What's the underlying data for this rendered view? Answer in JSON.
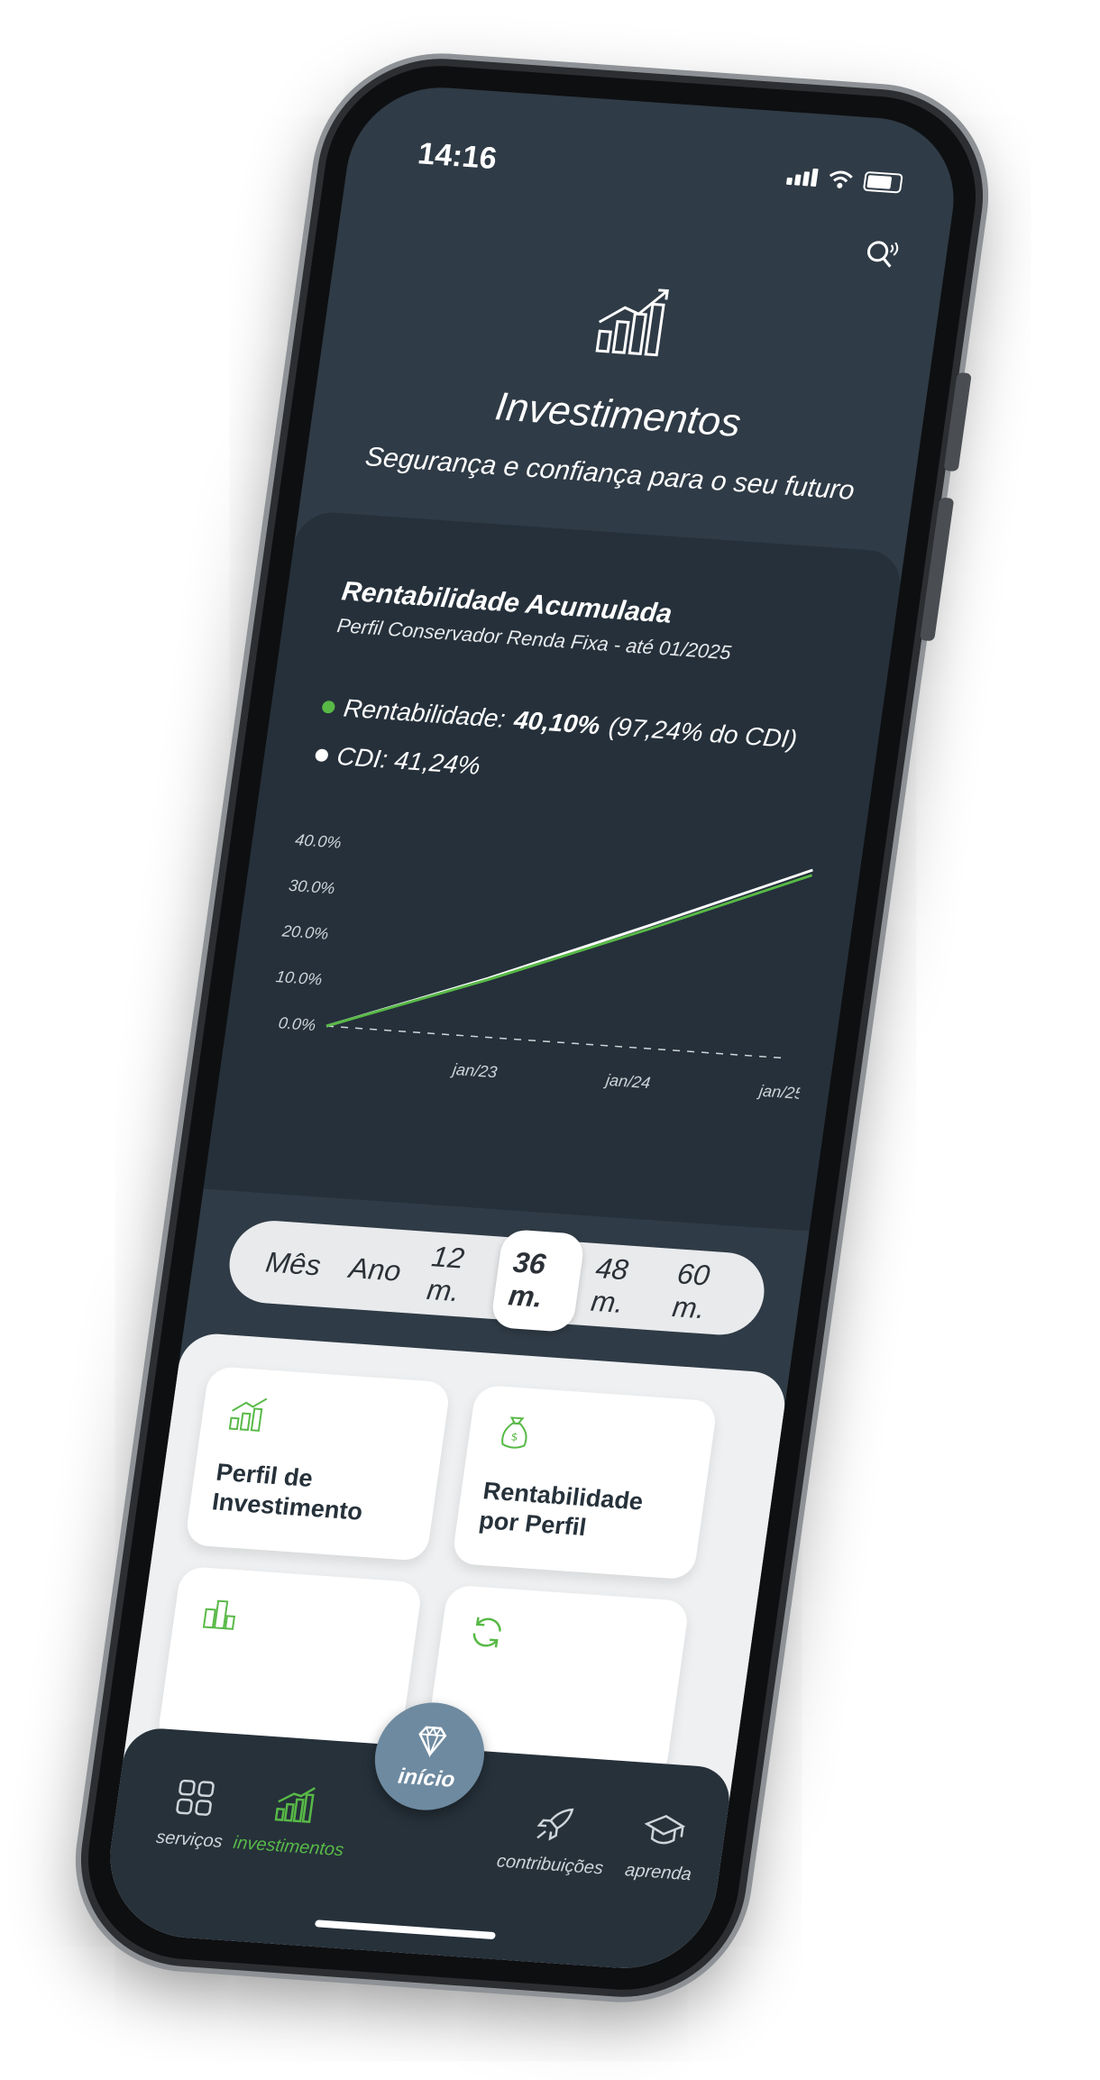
{
  "status_bar": {
    "time": "14:16"
  },
  "header": {
    "title": "Investimentos",
    "subtitle": "Segurança e confiança para o seu futuro"
  },
  "accumulated_card": {
    "title": "Rentabilidade Acumulada",
    "subtitle": "Perfil Conservador Renda Fixa - até 01/2025",
    "rentabilidade_prefix": "Rentabilidade:",
    "rentabilidade_value": "40,10%",
    "rentabilidade_suffix": "(97,24% do CDI)",
    "cdi_label": "CDI: 41,24%"
  },
  "chart_data": {
    "type": "line",
    "x": [
      "01/2022",
      "01/2023",
      "01/2024",
      "01/2025"
    ],
    "x_tick_labels": [
      "jan/23",
      "jan/24",
      "jan/25"
    ],
    "y_tick_labels": [
      "40.0%",
      "30.0%",
      "20.0%",
      "10.0%",
      "0.0%"
    ],
    "ylim": [
      0,
      45
    ],
    "series": [
      {
        "name": "Rentabilidade",
        "color": "#58b947",
        "values": [
          0,
          12.5,
          26.0,
          40.1
        ]
      },
      {
        "name": "CDI",
        "color": "#ffffff",
        "values": [
          0,
          12.8,
          26.8,
          41.24
        ]
      }
    ],
    "baseline_dashed": true
  },
  "period_selector": {
    "options": [
      "Mês",
      "Ano",
      "12 m.",
      "36 m.",
      "48 m.",
      "60 m."
    ],
    "selected": "36 m."
  },
  "tiles": [
    {
      "label": "Perfil de Investimento",
      "icon": "chart-coins-icon"
    },
    {
      "label": "Rentabilidade por Perfil",
      "icon": "money-bag-icon"
    },
    {
      "label": "",
      "icon": "bar-chart-doc-icon"
    },
    {
      "label": "",
      "icon": "refresh-icon"
    }
  ],
  "bottom_nav": {
    "items": [
      {
        "label": "serviços",
        "icon": "grid-icon"
      },
      {
        "label": "investimentos",
        "icon": "growth-chart-icon",
        "active": true
      },
      {
        "label": "contribuições",
        "icon": "rocket-icon"
      },
      {
        "label": "aprenda",
        "icon": "graduation-cap-icon"
      }
    ],
    "home_label": "início",
    "home_icon": "diamond-icon"
  },
  "colors": {
    "accent": "#58b947",
    "screen_bg": "#2f3b46",
    "card_bg": "#25303a"
  }
}
